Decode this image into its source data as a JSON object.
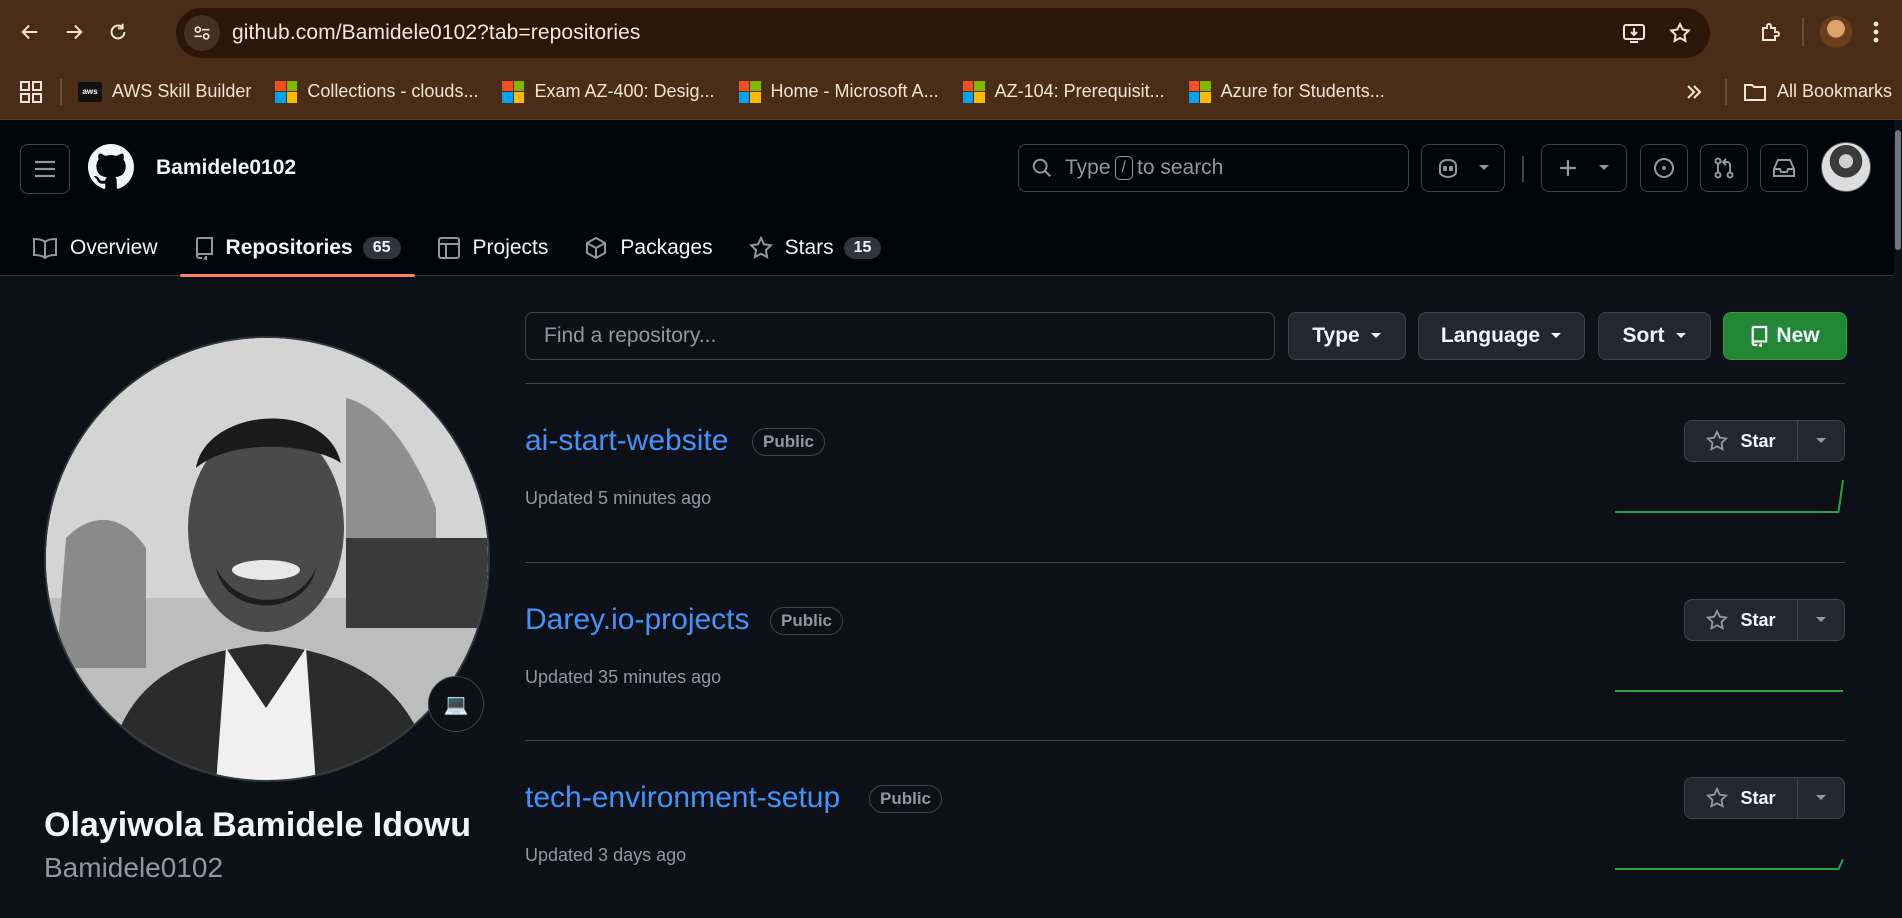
{
  "browser": {
    "url": "github.com/Bamidele0102?tab=repositories",
    "bookmarks": [
      {
        "label": "AWS Skill Builder",
        "icon": "aws-icon"
      },
      {
        "label": "Collections - clouds...",
        "icon": "microsoft-icon"
      },
      {
        "label": "Exam AZ-400: Desig...",
        "icon": "microsoft-icon"
      },
      {
        "label": "Home - Microsoft A...",
        "icon": "microsoft-icon"
      },
      {
        "label": "AZ-104: Prerequisit...",
        "icon": "microsoft-icon"
      },
      {
        "label": "Azure for Students...",
        "icon": "microsoft-icon"
      }
    ],
    "all_bookmarks_label": "All Bookmarks",
    "aws_icon_text": "aws"
  },
  "header": {
    "username": "Bamidele0102",
    "search_prefix": "Type",
    "search_key": "/",
    "search_suffix": "to search"
  },
  "tabs": [
    {
      "label": "Overview",
      "icon": "book-icon"
    },
    {
      "label": "Repositories",
      "count": "65",
      "icon": "repo-icon",
      "active": true
    },
    {
      "label": "Projects",
      "icon": "table-icon"
    },
    {
      "label": "Packages",
      "icon": "package-icon"
    },
    {
      "label": "Stars",
      "count": "15",
      "icon": "star-icon"
    }
  ],
  "profile": {
    "full_name": "Olayiwola Bamidele Idowu",
    "login": "Bamidele0102",
    "status_emoji": "💻"
  },
  "filters": {
    "search_placeholder": "Find a repository...",
    "type_label": "Type",
    "language_label": "Language",
    "sort_label": "Sort",
    "new_label": "New"
  },
  "repos": [
    {
      "name": "ai-start-website",
      "visibility": "Public",
      "updated": "Updated 5 minutes ago",
      "star_label": "Star",
      "activity": [
        0,
        0,
        0,
        0,
        0,
        0,
        0,
        0,
        0,
        0,
        0,
        0,
        0,
        0,
        0,
        0,
        0,
        0,
        0,
        0,
        0,
        0,
        0,
        0,
        0,
        0,
        0,
        0,
        0,
        0,
        0,
        0,
        0,
        0,
        0,
        0,
        0,
        0,
        0,
        0,
        0,
        0,
        0,
        0,
        0,
        0,
        0,
        0,
        0,
        0,
        0,
        1
      ]
    },
    {
      "name": "Darey.io-projects",
      "visibility": "Public",
      "updated": "Updated 35 minutes ago",
      "star_label": "Star",
      "activity": [
        0,
        0,
        0,
        0,
        0,
        0,
        0,
        0,
        0,
        0,
        0,
        0,
        0,
        0,
        0,
        0,
        0,
        0,
        0,
        0,
        0,
        0,
        0,
        0,
        0,
        0,
        0,
        0,
        0,
        0,
        0,
        0,
        0,
        0,
        0,
        0,
        0,
        0,
        0,
        0,
        0,
        0,
        0,
        0,
        0,
        0,
        0,
        0,
        0,
        0,
        0,
        0
      ]
    },
    {
      "name": "tech-environment-setup",
      "visibility": "Public",
      "updated": "Updated 3 days ago",
      "star_label": "Star",
      "activity": [
        0,
        0,
        0,
        0,
        0,
        0,
        0,
        0,
        0,
        0,
        0,
        0,
        0,
        0,
        0,
        0,
        0,
        0,
        0,
        0,
        0,
        0,
        0,
        0,
        0,
        0,
        0,
        0,
        0,
        0,
        0,
        0,
        0,
        0,
        0,
        0,
        0,
        0,
        0,
        0,
        0,
        0,
        0,
        0,
        0,
        0,
        0,
        0,
        0,
        0,
        0,
        0.3
      ]
    }
  ],
  "colors": {
    "link": "#4493f8",
    "tab_underline": "#f78166",
    "new_button": "#238636",
    "sparkline": "#2ea043",
    "chrome_brown": "#4a2d18"
  }
}
